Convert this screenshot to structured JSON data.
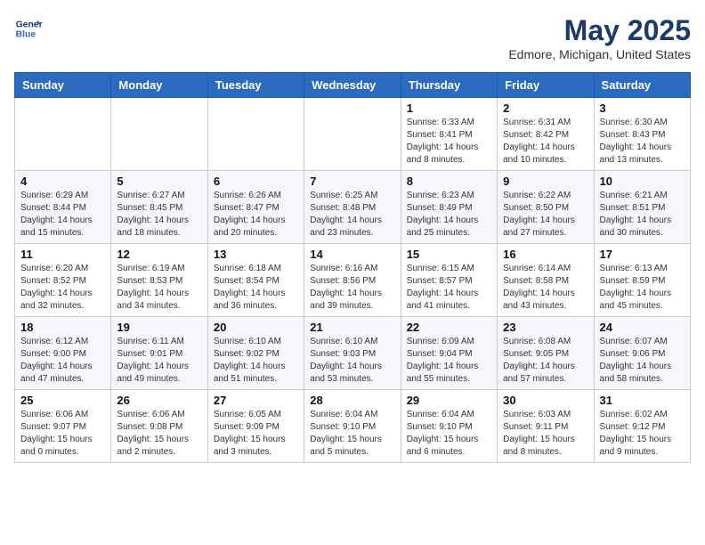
{
  "logo": {
    "line1": "General",
    "line2": "Blue"
  },
  "title": "May 2025",
  "location": "Edmore, Michigan, United States",
  "days_of_week": [
    "Sunday",
    "Monday",
    "Tuesday",
    "Wednesday",
    "Thursday",
    "Friday",
    "Saturday"
  ],
  "weeks": [
    [
      {
        "day": "",
        "info": ""
      },
      {
        "day": "",
        "info": ""
      },
      {
        "day": "",
        "info": ""
      },
      {
        "day": "",
        "info": ""
      },
      {
        "day": "1",
        "info": "Sunrise: 6:33 AM\nSunset: 8:41 PM\nDaylight: 14 hours\nand 8 minutes."
      },
      {
        "day": "2",
        "info": "Sunrise: 6:31 AM\nSunset: 8:42 PM\nDaylight: 14 hours\nand 10 minutes."
      },
      {
        "day": "3",
        "info": "Sunrise: 6:30 AM\nSunset: 8:43 PM\nDaylight: 14 hours\nand 13 minutes."
      }
    ],
    [
      {
        "day": "4",
        "info": "Sunrise: 6:29 AM\nSunset: 8:44 PM\nDaylight: 14 hours\nand 15 minutes."
      },
      {
        "day": "5",
        "info": "Sunrise: 6:27 AM\nSunset: 8:45 PM\nDaylight: 14 hours\nand 18 minutes."
      },
      {
        "day": "6",
        "info": "Sunrise: 6:26 AM\nSunset: 8:47 PM\nDaylight: 14 hours\nand 20 minutes."
      },
      {
        "day": "7",
        "info": "Sunrise: 6:25 AM\nSunset: 8:48 PM\nDaylight: 14 hours\nand 23 minutes."
      },
      {
        "day": "8",
        "info": "Sunrise: 6:23 AM\nSunset: 8:49 PM\nDaylight: 14 hours\nand 25 minutes."
      },
      {
        "day": "9",
        "info": "Sunrise: 6:22 AM\nSunset: 8:50 PM\nDaylight: 14 hours\nand 27 minutes."
      },
      {
        "day": "10",
        "info": "Sunrise: 6:21 AM\nSunset: 8:51 PM\nDaylight: 14 hours\nand 30 minutes."
      }
    ],
    [
      {
        "day": "11",
        "info": "Sunrise: 6:20 AM\nSunset: 8:52 PM\nDaylight: 14 hours\nand 32 minutes."
      },
      {
        "day": "12",
        "info": "Sunrise: 6:19 AM\nSunset: 8:53 PM\nDaylight: 14 hours\nand 34 minutes."
      },
      {
        "day": "13",
        "info": "Sunrise: 6:18 AM\nSunset: 8:54 PM\nDaylight: 14 hours\nand 36 minutes."
      },
      {
        "day": "14",
        "info": "Sunrise: 6:16 AM\nSunset: 8:56 PM\nDaylight: 14 hours\nand 39 minutes."
      },
      {
        "day": "15",
        "info": "Sunrise: 6:15 AM\nSunset: 8:57 PM\nDaylight: 14 hours\nand 41 minutes."
      },
      {
        "day": "16",
        "info": "Sunrise: 6:14 AM\nSunset: 8:58 PM\nDaylight: 14 hours\nand 43 minutes."
      },
      {
        "day": "17",
        "info": "Sunrise: 6:13 AM\nSunset: 8:59 PM\nDaylight: 14 hours\nand 45 minutes."
      }
    ],
    [
      {
        "day": "18",
        "info": "Sunrise: 6:12 AM\nSunset: 9:00 PM\nDaylight: 14 hours\nand 47 minutes."
      },
      {
        "day": "19",
        "info": "Sunrise: 6:11 AM\nSunset: 9:01 PM\nDaylight: 14 hours\nand 49 minutes."
      },
      {
        "day": "20",
        "info": "Sunrise: 6:10 AM\nSunset: 9:02 PM\nDaylight: 14 hours\nand 51 minutes."
      },
      {
        "day": "21",
        "info": "Sunrise: 6:10 AM\nSunset: 9:03 PM\nDaylight: 14 hours\nand 53 minutes."
      },
      {
        "day": "22",
        "info": "Sunrise: 6:09 AM\nSunset: 9:04 PM\nDaylight: 14 hours\nand 55 minutes."
      },
      {
        "day": "23",
        "info": "Sunrise: 6:08 AM\nSunset: 9:05 PM\nDaylight: 14 hours\nand 57 minutes."
      },
      {
        "day": "24",
        "info": "Sunrise: 6:07 AM\nSunset: 9:06 PM\nDaylight: 14 hours\nand 58 minutes."
      }
    ],
    [
      {
        "day": "25",
        "info": "Sunrise: 6:06 AM\nSunset: 9:07 PM\nDaylight: 15 hours\nand 0 minutes."
      },
      {
        "day": "26",
        "info": "Sunrise: 6:06 AM\nSunset: 9:08 PM\nDaylight: 15 hours\nand 2 minutes."
      },
      {
        "day": "27",
        "info": "Sunrise: 6:05 AM\nSunset: 9:09 PM\nDaylight: 15 hours\nand 3 minutes."
      },
      {
        "day": "28",
        "info": "Sunrise: 6:04 AM\nSunset: 9:10 PM\nDaylight: 15 hours\nand 5 minutes."
      },
      {
        "day": "29",
        "info": "Sunrise: 6:04 AM\nSunset: 9:10 PM\nDaylight: 15 hours\nand 6 minutes."
      },
      {
        "day": "30",
        "info": "Sunrise: 6:03 AM\nSunset: 9:11 PM\nDaylight: 15 hours\nand 8 minutes."
      },
      {
        "day": "31",
        "info": "Sunrise: 6:02 AM\nSunset: 9:12 PM\nDaylight: 15 hours\nand 9 minutes."
      }
    ]
  ]
}
